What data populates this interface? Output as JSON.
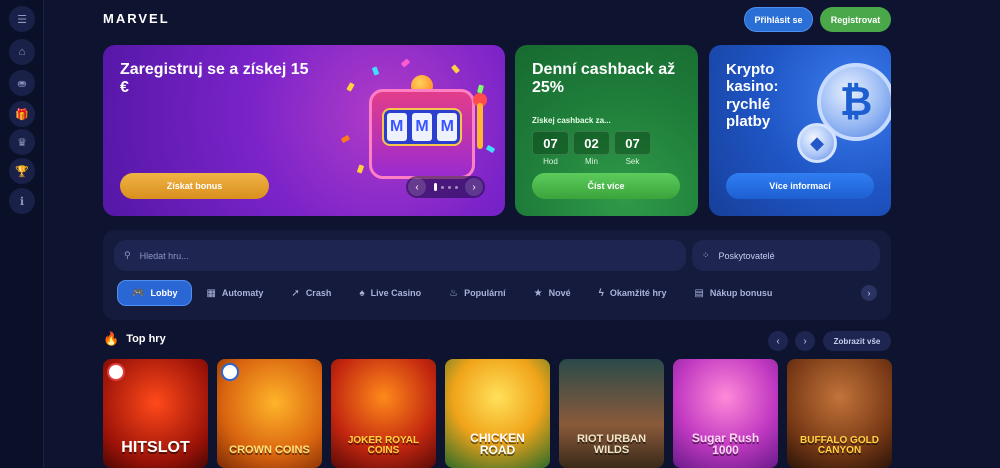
{
  "app": {
    "logo": "MARVEL"
  },
  "header": {
    "login_label": "Přihlásit se",
    "register_label": "Registrovat"
  },
  "sidebar": {
    "icons": [
      "menu-icon",
      "home-icon",
      "chips-icon",
      "gift-icon",
      "crown-icon",
      "trophy-icon",
      "info-icon"
    ]
  },
  "promo": {
    "welcome": {
      "title": "Zaregistruj se a získej 15 €",
      "button": "Získat bonus"
    },
    "cashback": {
      "title": "Denní cashback až 25%",
      "subtitle": "Získej cashback za...",
      "timer": [
        {
          "value": "07",
          "label": "Hod"
        },
        {
          "value": "02",
          "label": "Min"
        },
        {
          "value": "07",
          "label": "Sek"
        }
      ],
      "button": "Číst více"
    },
    "crypto": {
      "title": "Krypto kasino: rychlé platby",
      "button": "Více informací"
    }
  },
  "search": {
    "placeholder": "Hledat hru...",
    "providers_label": "Poskytovatelé"
  },
  "tabs": [
    {
      "label": "Lobby",
      "icon": "gamepad-icon",
      "active": true
    },
    {
      "label": "Automaty",
      "icon": "slot-icon",
      "active": false
    },
    {
      "label": "Crash",
      "icon": "rocket-icon",
      "active": false
    },
    {
      "label": "Live Casino",
      "icon": "cards-icon",
      "active": false
    },
    {
      "label": "Populární",
      "icon": "fire-icon",
      "active": false
    },
    {
      "label": "Nové",
      "icon": "star-icon",
      "active": false
    },
    {
      "label": "Okamžité hry",
      "icon": "lightning-icon",
      "active": false
    },
    {
      "label": "Nákup bonusu",
      "icon": "ticket-icon",
      "active": false
    }
  ],
  "top_games": {
    "title": "Top hry",
    "show_all": "Zobrazit vše",
    "games": [
      {
        "name": "HITSLOT"
      },
      {
        "name": "CROWN COINS"
      },
      {
        "name": "JOKER ROYAL COINS"
      },
      {
        "name": "CHICKEN ROAD"
      },
      {
        "name": "RIOT URBAN WILDS"
      },
      {
        "name": "Sugar Rush 1000"
      },
      {
        "name": "BUFFALO GOLD CANYON"
      }
    ]
  },
  "colors": {
    "background": "#0e1330",
    "accent_blue": "#2a66d4",
    "accent_green": "#4aa84a",
    "accent_orange": "#f0b445"
  }
}
